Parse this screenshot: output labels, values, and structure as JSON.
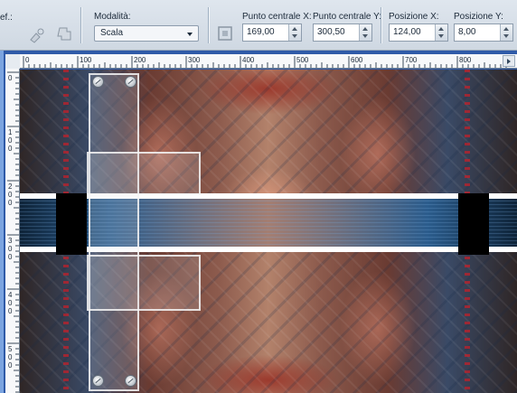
{
  "toolbar": {
    "preset_label_fragment": "ef.:",
    "mode_label": "Modalità:",
    "mode_value": "Scala",
    "center_x_label": "Punto centrale X:",
    "center_x_value": "169,00",
    "center_y_label": "Punto centrale Y:",
    "center_y_value": "300,50",
    "pos_x_label": "Posizione X:",
    "pos_x_value": "124,00",
    "pos_y_label": "Posizione Y:",
    "pos_y_value": "8,00"
  },
  "ruler": {
    "h_labels": [
      "0",
      "100",
      "200",
      "300",
      "400",
      "500",
      "600",
      "700",
      "800"
    ],
    "v_labels": [
      "0",
      "1 0 0",
      "2 0 0",
      "3 0 0",
      "4 0 0",
      "5 0 0"
    ]
  },
  "colors": {
    "accent": "#2f5aa8",
    "toolbar_bg": "#d6dee7",
    "dot_red": "#c0202a"
  },
  "icons": {
    "preset_icon": "stamp-icon",
    "mode_icon": "transform-icon",
    "center_icon": "center-point-icon"
  }
}
